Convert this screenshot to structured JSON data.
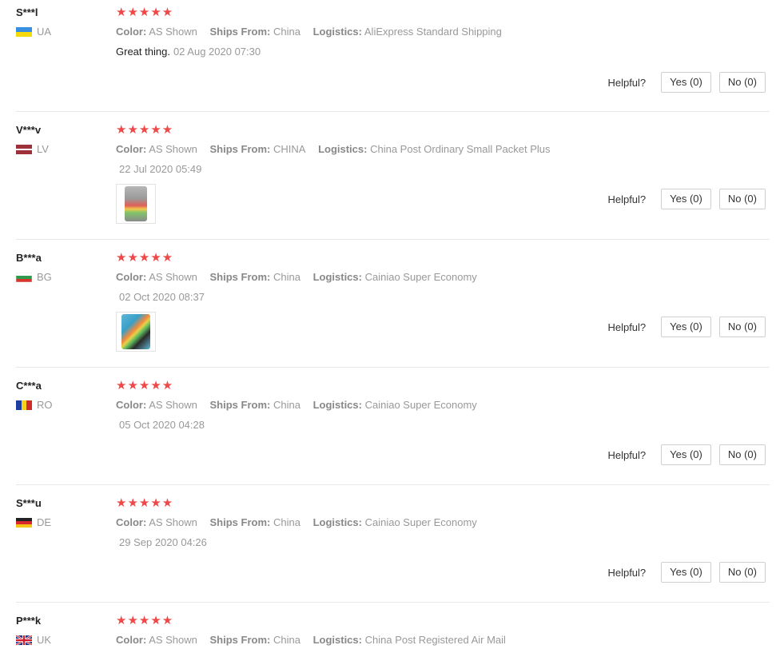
{
  "helpful_label": "Helpful?",
  "reviews": [
    {
      "buyer": "S***l",
      "country": "UA",
      "flag": "ua-flag",
      "stars": "★★★★★",
      "color_label": "Color:",
      "color": "AS Shown",
      "ships_label": "Ships From:",
      "ships": "China",
      "logistics_label": "Logistics:",
      "logistics": "AliExpress Standard Shipping",
      "text": "Great thing.",
      "date": "02 Aug 2020 07:30",
      "yes": "Yes (0)",
      "no": "No (0)"
    },
    {
      "buyer": "V***v",
      "country": "LV",
      "flag": "lv-flag",
      "stars": "★★★★★",
      "color_label": "Color:",
      "color": "AS Shown",
      "ships_label": "Ships From:",
      "ships": "CHINA",
      "logistics_label": "Logistics:",
      "logistics": "China Post Ordinary Small Packet Plus",
      "text": "",
      "date": "22 Jul 2020 05:49",
      "yes": "Yes (0)",
      "no": "No (0)"
    },
    {
      "buyer": "B***a",
      "country": "BG",
      "flag": "bg-flag",
      "stars": "★★★★★",
      "color_label": "Color:",
      "color": "AS Shown",
      "ships_label": "Ships From:",
      "ships": "China",
      "logistics_label": "Logistics:",
      "logistics": "Cainiao Super Economy",
      "text": "",
      "date": "02 Oct 2020 08:37",
      "yes": "Yes (0)",
      "no": "No (0)"
    },
    {
      "buyer": "C***a",
      "country": "RO",
      "flag": "ro-flag",
      "stars": "★★★★★",
      "color_label": "Color:",
      "color": "AS Shown",
      "ships_label": "Ships From:",
      "ships": "China",
      "logistics_label": "Logistics:",
      "logistics": "Cainiao Super Economy",
      "text": "",
      "date": "05 Oct 2020 04:28",
      "yes": "Yes (0)",
      "no": "No (0)"
    },
    {
      "buyer": "S***u",
      "country": "DE",
      "flag": "de-flag",
      "stars": "★★★★★",
      "color_label": "Color:",
      "color": "AS Shown",
      "ships_label": "Ships From:",
      "ships": "China",
      "logistics_label": "Logistics:",
      "logistics": "Cainiao Super Economy",
      "text": "",
      "date": "29 Sep 2020 04:26",
      "yes": "Yes (0)",
      "no": "No (0)"
    },
    {
      "buyer": "P***k",
      "country": "UK",
      "flag": "uk-flag",
      "stars": "★★★★★",
      "color_label": "Color:",
      "color": "AS Shown",
      "ships_label": "Ships From:",
      "ships": "China",
      "logistics_label": "Logistics:",
      "logistics": "China Post Registered Air Mail",
      "text": "",
      "date": "",
      "yes": "",
      "no": ""
    }
  ]
}
